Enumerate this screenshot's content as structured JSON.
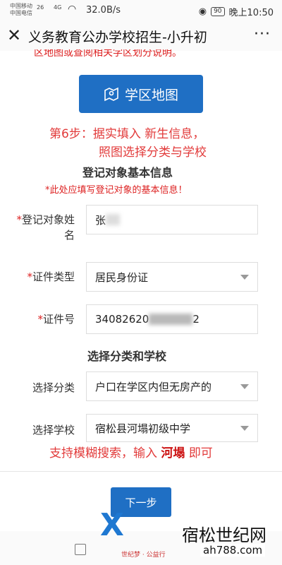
{
  "status_bar": {
    "carrier1": "中国移动",
    "carrier2": "中国电信",
    "signal1": "26",
    "signal2": "4G",
    "speed": "32.0B/s",
    "battery": "90",
    "time": "晚上10:50"
  },
  "header": {
    "close": "✕",
    "title": "义务教育公办学校招生-小升初",
    "more": "···"
  },
  "top_cut_text": "区地图或查阅相关学区划分说明。",
  "map_button": {
    "label": "学区地图"
  },
  "step_annotation": {
    "line1": "第6步：据实填入 新生信息，",
    "line2": "照图选择分类与学校"
  },
  "section_basic": {
    "title": "登记对象基本信息",
    "warning": "*此处应填写登记对象的基本信息！"
  },
  "form": {
    "name_label_line1": "登记对象姓",
    "name_label_line2": "名",
    "name_value": "张",
    "id_type_label": "证件类型",
    "id_type_value": "居民身份证",
    "id_no_label": "证件号",
    "id_no_prefix": "34082620",
    "id_no_suffix": "2",
    "required_mark": "*"
  },
  "section_school": {
    "title": "选择分类和学校",
    "category_label": "选择分类",
    "category_value": "户口在学区内但无房产的",
    "school_label": "选择学校",
    "school_value": "宿松县河塌初级中学"
  },
  "hint": {
    "prefix": "支持模糊搜索，输入",
    "keyword": "河塌",
    "suffix": "即可"
  },
  "next_button": {
    "label": "下一步"
  },
  "watermark": {
    "logo_text": "X",
    "tagline": "世纪梦 · 公益行",
    "site_name": "宿松世纪网",
    "url": "ah788.com"
  }
}
